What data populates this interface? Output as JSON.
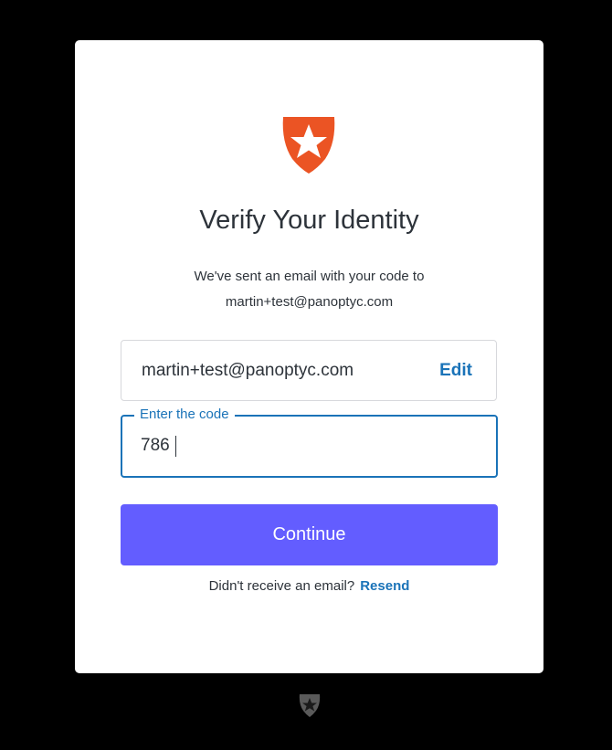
{
  "brand": {
    "logo_icon": "auth0-shield-star-icon",
    "logo_color": "#eb5424",
    "footer_icon": "auth0-shield-icon"
  },
  "header": {
    "title": "Verify Your Identity",
    "subtitle_line1": "We've sent an email with your code to",
    "subtitle_line2": "martin+test@panoptyc.com"
  },
  "email_box": {
    "value": "martin+test@panoptyc.com",
    "edit_label": "Edit"
  },
  "code_field": {
    "label": "Enter the code",
    "value": "786"
  },
  "actions": {
    "continue_label": "Continue",
    "continue_color": "#635dff"
  },
  "resend": {
    "prompt": "Didn't receive an email?",
    "link_label": "Resend"
  },
  "colors": {
    "link": "#1a73b8",
    "text": "#2d333a",
    "background": "#000000",
    "card": "#ffffff"
  }
}
